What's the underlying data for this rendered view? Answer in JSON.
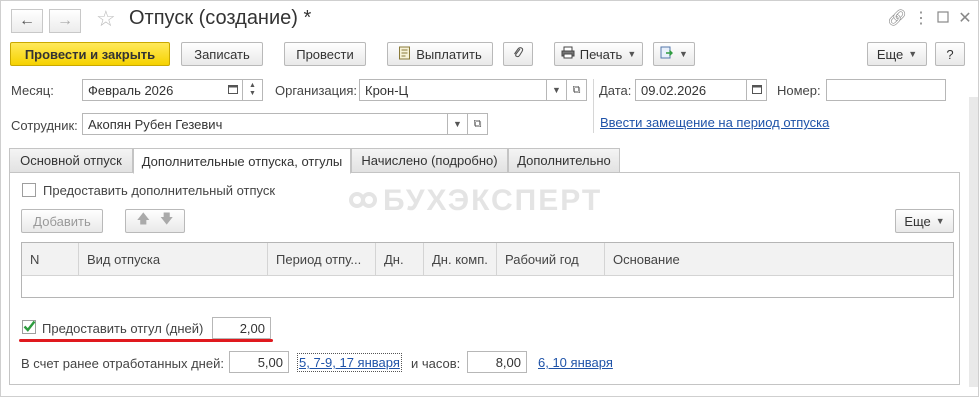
{
  "window": {
    "title": "Отпуск (создание) *"
  },
  "toolbar": {
    "post_close": "Провести и закрыть",
    "save": "Записать",
    "post": "Провести",
    "pay": "Выплатить",
    "print": "Печать",
    "more": "Еще",
    "help": "?"
  },
  "header": {
    "month_label": "Месяц:",
    "month_value": "Февраль 2026",
    "org_label": "Организация:",
    "org_value": "Крон-Ц",
    "date_label": "Дата:",
    "date_value": "09.02.2026",
    "number_label": "Номер:",
    "number_value": "",
    "employee_label": "Сотрудник:",
    "employee_value": "Акопян Рубен Гезевич",
    "replacement_link": "Ввести замещение на период отпуска"
  },
  "tabs": [
    {
      "label": "Основной отпуск",
      "active": false
    },
    {
      "label": "Дополнительные отпуска, отгулы",
      "active": true
    },
    {
      "label": "Начислено (подробно)",
      "active": false
    },
    {
      "label": "Дополнительно",
      "active": false
    }
  ],
  "panel": {
    "grant_additional_label": "Предоставить дополнительный отпуск",
    "grant_additional_checked": false,
    "add_button": "Добавить",
    "more_button": "Еще",
    "watermark": "БУХЭКСПЕРТ",
    "table_columns": [
      "N",
      "Вид отпуска",
      "Период отпу...",
      "Дн.",
      "Дн. комп.",
      "Рабочий год",
      "Основание"
    ],
    "time_off_label": "Предоставить отгул (дней)",
    "time_off_checked": true,
    "time_off_days": "2,00",
    "worked_days_label": "В счет ранее отработанных дней:",
    "worked_days_value": "5,00",
    "worked_days_link": "5, 7-9, 17 января",
    "hours_label": "и часов:",
    "hours_value": "8,00",
    "hours_link": "6, 10 января"
  },
  "colors": {
    "primary_button": "#f6d200",
    "link": "#1f53a8",
    "checkbox_check": "#2e9c3f",
    "annotation_underline": "#e0191e"
  },
  "icons": {
    "back": "arrow-left-icon",
    "forward": "arrow-right-icon",
    "favorite": "star-icon",
    "link": "link-icon",
    "menu": "more-vert-icon",
    "maximize": "maximize-icon",
    "close": "close-icon"
  }
}
